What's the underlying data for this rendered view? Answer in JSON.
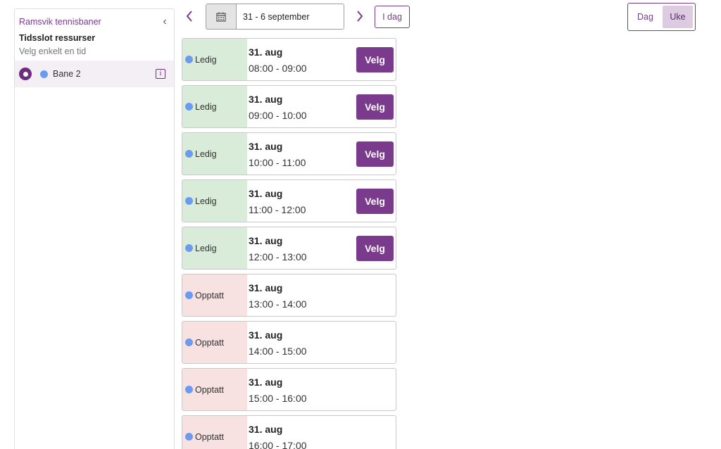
{
  "sidebar": {
    "title": "Ramsvik tennisbaner",
    "section_title": "Tidsslot ressurser",
    "subtitle": "Velg enkelt en tid",
    "resource": {
      "name": "Bane 2",
      "dot_color": "#6b9bf0",
      "info_icon": "info-icon"
    }
  },
  "toolbar": {
    "date_range": "31 - 6 september",
    "today_label": "I dag",
    "view_day": "Dag",
    "view_week": "Uke",
    "active_view": "Uke"
  },
  "colors": {
    "accent": "#7b3b8c",
    "free_bg": "#d9ecd9",
    "busy_bg": "#f7e1e1",
    "dot": "#6b9bf0"
  },
  "slots": [
    {
      "status": "Ledig",
      "date": "31. aug",
      "time": "08:00 - 09:00",
      "button": "Velg"
    },
    {
      "status": "Ledig",
      "date": "31. aug",
      "time": "09:00 - 10:00",
      "button": "Velg"
    },
    {
      "status": "Ledig",
      "date": "31. aug",
      "time": "10:00 - 11:00",
      "button": "Velg"
    },
    {
      "status": "Ledig",
      "date": "31. aug",
      "time": "11:00 - 12:00",
      "button": "Velg"
    },
    {
      "status": "Ledig",
      "date": "31. aug",
      "time": "12:00 - 13:00",
      "button": "Velg"
    },
    {
      "status": "Opptatt",
      "date": "31. aug",
      "time": "13:00 - 14:00"
    },
    {
      "status": "Opptatt",
      "date": "31. aug",
      "time": "14:00 - 15:00"
    },
    {
      "status": "Opptatt",
      "date": "31. aug",
      "time": "15:00 - 16:00"
    },
    {
      "status": "Opptatt",
      "date": "31. aug",
      "time": "16:00 - 17:00"
    }
  ]
}
